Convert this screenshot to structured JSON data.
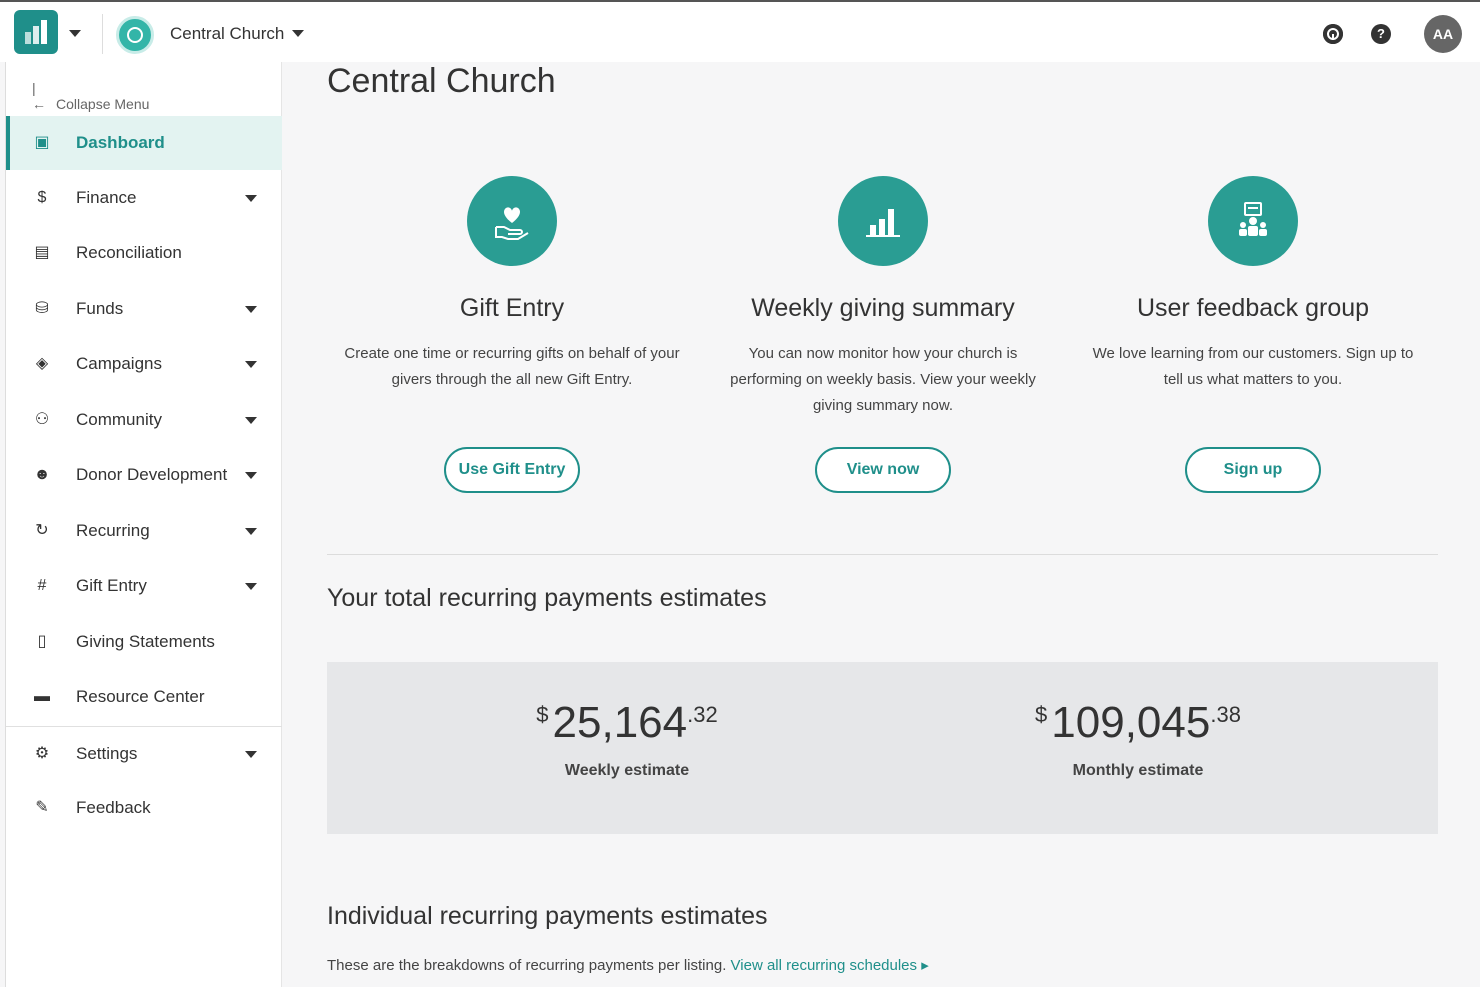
{
  "header": {
    "org_name": "Central Church",
    "help_icon_glyph": "?",
    "avatar_initials": "AA"
  },
  "sidebar": {
    "collapse_label": "Collapse Menu",
    "items": [
      {
        "label": "Dashboard",
        "icon": "dashboard-icon",
        "glyph": "▣",
        "has_caret": false,
        "active": true
      },
      {
        "label": "Finance",
        "icon": "dollar-icon",
        "glyph": "$",
        "has_caret": true
      },
      {
        "label": "Reconciliation",
        "icon": "calculator-icon",
        "glyph": "▤",
        "has_caret": false
      },
      {
        "label": "Funds",
        "icon": "coins-icon",
        "glyph": "⛁",
        "has_caret": true
      },
      {
        "label": "Campaigns",
        "icon": "megaphone-icon",
        "glyph": "◈",
        "has_caret": true
      },
      {
        "label": "Community",
        "icon": "people-icon",
        "glyph": "⚇",
        "has_caret": true
      },
      {
        "label": "Donor Development",
        "icon": "donor-icon",
        "glyph": "☻",
        "has_caret": true
      },
      {
        "label": "Recurring",
        "icon": "recurring-icon",
        "glyph": "↻",
        "has_caret": true
      },
      {
        "label": "Gift Entry",
        "icon": "gift-entry-icon",
        "glyph": "#",
        "has_caret": true
      },
      {
        "label": "Giving Statements",
        "icon": "statement-icon",
        "glyph": "▯",
        "has_caret": false
      },
      {
        "label": "Resource Center",
        "icon": "resource-icon",
        "glyph": "▬",
        "has_caret": false
      },
      {
        "label": "Settings",
        "icon": "gear-icon",
        "glyph": "⚙",
        "has_caret": true
      },
      {
        "label": "Feedback",
        "icon": "pencil-icon",
        "glyph": "✎",
        "has_caret": false
      }
    ]
  },
  "main": {
    "title": "Central Church",
    "cards": [
      {
        "title": "Gift Entry",
        "description": "Create one time or recurring gifts on behalf of your givers through the all new Gift Entry.",
        "button": "Use Gift Entry",
        "icon": "heart-hand-icon"
      },
      {
        "title": "Weekly giving summary",
        "description": "You can now monitor how your church is performing on weekly basis. View your weekly giving summary now.",
        "button": "View now",
        "icon": "bar-chart-icon"
      },
      {
        "title": "User feedback group",
        "description": "We love learning from our customers. Sign up to tell us what matters to you.",
        "button": "Sign up",
        "icon": "feedback-group-icon"
      }
    ],
    "totals_title": "Your total recurring payments estimates",
    "estimates": [
      {
        "currency": "$",
        "whole": "25,164",
        "cents": ".32",
        "label": "Weekly estimate"
      },
      {
        "currency": "$",
        "whole": "109,045",
        "cents": ".38",
        "label": "Monthly estimate"
      }
    ],
    "individual_title": "Individual recurring payments estimates",
    "individual_desc": "These are the breakdowns of recurring payments per listing.",
    "individual_link": "View all recurring schedules ▸"
  },
  "colors": {
    "accent": "#1f8f8a",
    "accent_circle": "#2a9d93",
    "active_bg": "#e3f3f1",
    "estimate_bg": "#e6e7e9"
  }
}
